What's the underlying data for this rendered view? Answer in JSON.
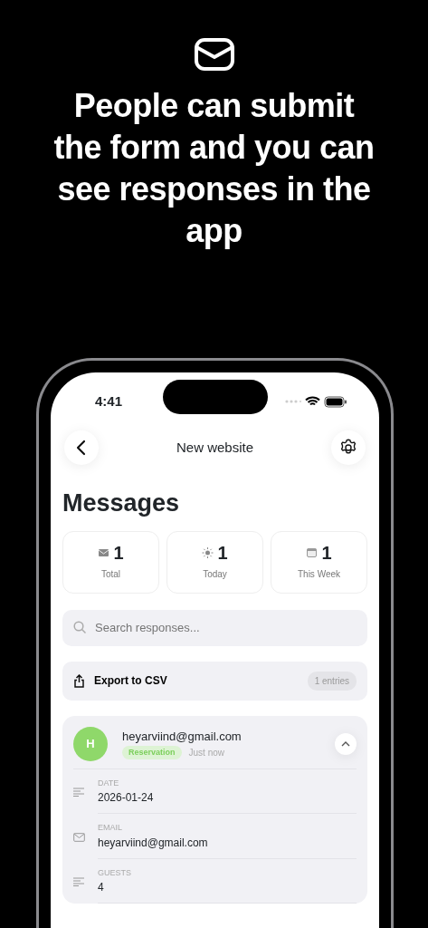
{
  "headline": "People can submit the form and you can see responses in the app",
  "status_bar": {
    "time": "4:41"
  },
  "nav": {
    "title": "New website"
  },
  "page_title": "Messages",
  "stats": [
    {
      "kind": "total",
      "value": "1",
      "label": "Total"
    },
    {
      "kind": "today",
      "value": "1",
      "label": "Today"
    },
    {
      "kind": "week",
      "value": "1",
      "label": "This Week"
    }
  ],
  "search": {
    "placeholder": "Search responses..."
  },
  "export": {
    "label": "Export to CSV",
    "count": "1 entries"
  },
  "responses": [
    {
      "initial": "H",
      "color": "#8fd86a",
      "sender": "heyarviind@gmail.com",
      "tag": "Reservation",
      "time": "Just now",
      "expanded": true,
      "fields": [
        {
          "kind": "text",
          "label": "DATE",
          "value": "2026-01-24"
        },
        {
          "kind": "email",
          "label": "EMAIL",
          "value": "heyarviind@gmail.com"
        },
        {
          "kind": "text",
          "label": "GUESTS",
          "value": "4"
        }
      ]
    }
  ]
}
